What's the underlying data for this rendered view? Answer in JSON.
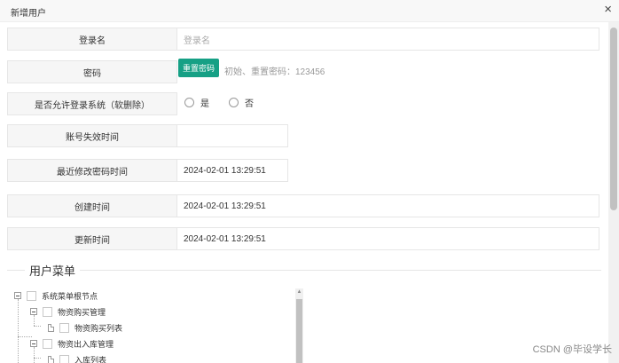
{
  "dialog": {
    "title": "新增用户",
    "close_glyph": "×"
  },
  "form": {
    "login_name": {
      "label": "登录名",
      "placeholder": "登录名"
    },
    "password": {
      "label": "密码",
      "reset_button": "重置密码",
      "hint": "初始、重置密码：123456"
    },
    "allow_login": {
      "label": "是否允许登录系统（软删除）",
      "yes": "是",
      "no": "否"
    },
    "expire_time": {
      "label": "账号失效时间",
      "value": ""
    },
    "pwd_modified": {
      "label": "最近修改密码时间",
      "value": "2024-02-01 13:29:51"
    },
    "created": {
      "label": "创建时间",
      "value": "2024-02-01 13:29:51"
    },
    "updated": {
      "label": "更新时间",
      "value": "2024-02-01 13:29:51"
    }
  },
  "menu_section": {
    "title": "用户菜单",
    "tree": [
      "系统菜单根节点",
      "物资购买管理",
      "物资购买列表",
      "物资出入库管理",
      "入库列表"
    ]
  },
  "watermark": "CSDN @毕设学长",
  "icons": {
    "close": "close-icon",
    "toggle": "tree-toggle-icon",
    "doc": "tree-doc-icon"
  },
  "colors": {
    "primary_button": "#16a085"
  }
}
